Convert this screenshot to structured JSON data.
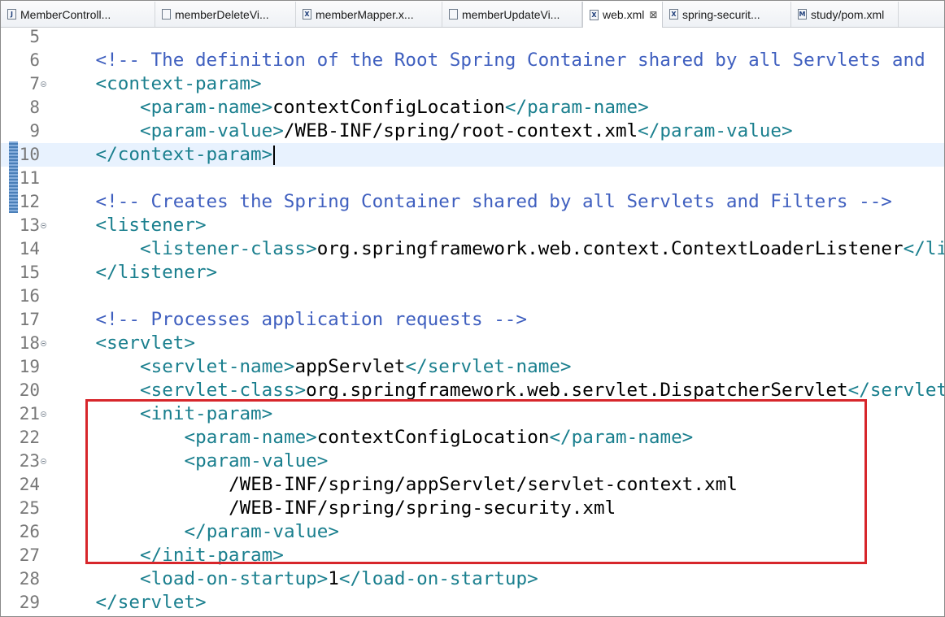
{
  "tabs": [
    {
      "label": "MemberControll...",
      "icon": "java-file-icon",
      "icon_glyph": "J",
      "active": false
    },
    {
      "label": "memberDeleteVi...",
      "icon": "jsp-file-icon",
      "icon_glyph": "",
      "active": false
    },
    {
      "label": "memberMapper.x...",
      "icon": "xml-file-icon",
      "icon_glyph": "X",
      "active": false
    },
    {
      "label": "memberUpdateVi...",
      "icon": "jsp-file-icon",
      "icon_glyph": "",
      "active": false
    },
    {
      "label": "web.xml",
      "icon": "xml-file-icon",
      "icon_glyph": "X",
      "active": true,
      "close": "⊠"
    },
    {
      "label": "spring-securit...",
      "icon": "xml-file-icon",
      "icon_glyph": "X",
      "active": false
    },
    {
      "label": "study/pom.xml",
      "icon": "maven-file-icon",
      "icon_glyph": "M",
      "active": false
    }
  ],
  "editor": {
    "lines": [
      {
        "n": "5",
        "indent": 0,
        "parts": []
      },
      {
        "n": "6",
        "indent": 1,
        "parts": [
          {
            "t": "cmt",
            "v": "<!-- The definition of the Root Spring Container shared by all Servlets and"
          }
        ]
      },
      {
        "n": "7",
        "indent": 1,
        "fold": true,
        "parts": [
          {
            "t": "tag",
            "v": "<context-param>"
          }
        ]
      },
      {
        "n": "8",
        "indent": 2,
        "parts": [
          {
            "t": "tag",
            "v": "<param-name>"
          },
          {
            "t": "txt",
            "v": "contextConfigLocation"
          },
          {
            "t": "tag",
            "v": "</param-name>"
          }
        ]
      },
      {
        "n": "9",
        "indent": 2,
        "parts": [
          {
            "t": "tag",
            "v": "<param-value>"
          },
          {
            "t": "txt",
            "v": "/WEB-INF/spring/root-context.xml"
          },
          {
            "t": "tag",
            "v": "</param-value>"
          }
        ]
      },
      {
        "n": "10",
        "indent": 1,
        "current": true,
        "caret": true,
        "parts": [
          {
            "t": "tag",
            "v": "</context-param>"
          }
        ]
      },
      {
        "n": "11",
        "indent": 0,
        "parts": []
      },
      {
        "n": "12",
        "indent": 1,
        "parts": [
          {
            "t": "cmt",
            "v": "<!-- Creates the Spring Container shared by all Servlets and Filters -->"
          }
        ]
      },
      {
        "n": "13",
        "indent": 1,
        "fold": true,
        "parts": [
          {
            "t": "tag",
            "v": "<listener>"
          }
        ]
      },
      {
        "n": "14",
        "indent": 2,
        "parts": [
          {
            "t": "tag",
            "v": "<listener-class>"
          },
          {
            "t": "txt",
            "v": "org.springframework.web.context.ContextLoaderListener"
          },
          {
            "t": "tag",
            "v": "</listener-class>"
          }
        ]
      },
      {
        "n": "15",
        "indent": 1,
        "parts": [
          {
            "t": "tag",
            "v": "</listener>"
          }
        ]
      },
      {
        "n": "16",
        "indent": 0,
        "parts": []
      },
      {
        "n": "17",
        "indent": 1,
        "parts": [
          {
            "t": "cmt",
            "v": "<!-- Processes application requests -->"
          }
        ]
      },
      {
        "n": "18",
        "indent": 1,
        "fold": true,
        "parts": [
          {
            "t": "tag",
            "v": "<servlet>"
          }
        ]
      },
      {
        "n": "19",
        "indent": 2,
        "parts": [
          {
            "t": "tag",
            "v": "<servlet-name>"
          },
          {
            "t": "txt",
            "v": "appServlet"
          },
          {
            "t": "tag",
            "v": "</servlet-name>"
          }
        ]
      },
      {
        "n": "20",
        "indent": 2,
        "parts": [
          {
            "t": "tag",
            "v": "<servlet-class>"
          },
          {
            "t": "txt",
            "v": "org.springframework.web.servlet.DispatcherServlet"
          },
          {
            "t": "tag",
            "v": "</servlet-class>"
          }
        ]
      },
      {
        "n": "21",
        "indent": 2,
        "fold": true,
        "parts": [
          {
            "t": "tag",
            "v": "<init-param>"
          }
        ]
      },
      {
        "n": "22",
        "indent": 3,
        "parts": [
          {
            "t": "tag",
            "v": "<param-name>"
          },
          {
            "t": "txt",
            "v": "contextConfigLocation"
          },
          {
            "t": "tag",
            "v": "</param-name>"
          }
        ]
      },
      {
        "n": "23",
        "indent": 3,
        "fold": true,
        "parts": [
          {
            "t": "tag",
            "v": "<param-value>"
          }
        ]
      },
      {
        "n": "24",
        "indent": 4,
        "parts": [
          {
            "t": "txt",
            "v": "/WEB-INF/spring/appServlet/servlet-context.xml"
          }
        ]
      },
      {
        "n": "25",
        "indent": 4,
        "parts": [
          {
            "t": "txt",
            "v": "/WEB-INF/spring/spring-security.xml"
          }
        ]
      },
      {
        "n": "26",
        "indent": 3,
        "parts": [
          {
            "t": "tag",
            "v": "</param-value>"
          }
        ]
      },
      {
        "n": "27",
        "indent": 2,
        "parts": [
          {
            "t": "tag",
            "v": "</init-param>"
          }
        ]
      },
      {
        "n": "28",
        "indent": 2,
        "parts": [
          {
            "t": "tag",
            "v": "<load-on-startup>"
          },
          {
            "t": "txt",
            "v": "1"
          },
          {
            "t": "tag",
            "v": "</load-on-startup>"
          }
        ]
      },
      {
        "n": "29",
        "indent": 1,
        "parts": [
          {
            "t": "tag",
            "v": "</servlet>"
          }
        ]
      }
    ]
  },
  "colors": {
    "tag": "#1a7f8e",
    "comment": "#3f5fbf",
    "text": "#000000",
    "highlight_box": "#d7262b",
    "current_line": "#e8f2fe"
  }
}
